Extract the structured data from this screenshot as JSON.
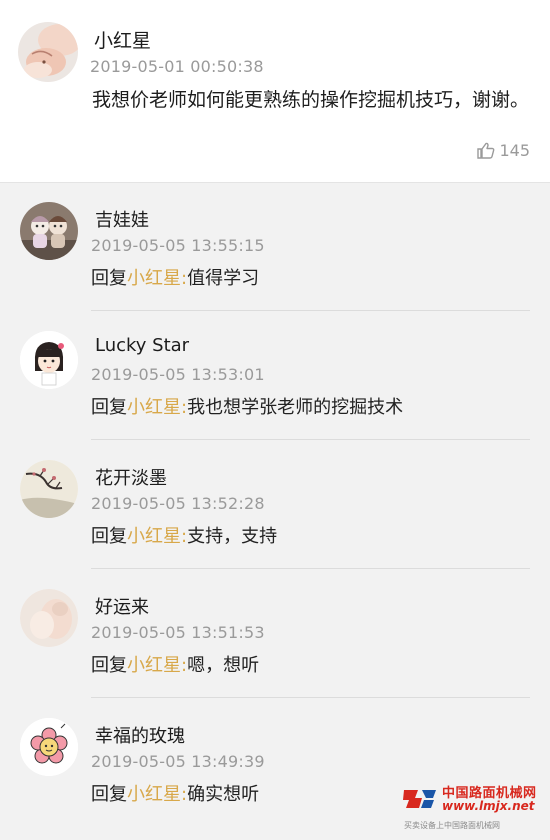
{
  "main_comment": {
    "avatar": "baby-photo-avatar",
    "username": "小红星",
    "timestamp": "2019-05-01 00:50:38",
    "text": "我想价老师如何能更熟练的操作挖掘机技巧，谢谢。",
    "likes": "145",
    "like_icon": "thumbs-up-icon"
  },
  "replies": [
    {
      "avatar": "doll-couple-avatar",
      "username": "吉娃娃",
      "timestamp": "2019-05-05 13:55:15",
      "prefix": "回复",
      "target": "小红星",
      "colon": ":",
      "text": "值得学习"
    },
    {
      "avatar": "cartoon-girl-avatar",
      "username": "Lucky Star",
      "timestamp": "2019-05-05 13:53:01",
      "prefix": "回复",
      "target": "小红星",
      "colon": ":",
      "text": "我也想学张老师的挖掘技术"
    },
    {
      "avatar": "ink-painting-avatar",
      "username": "花开淡墨",
      "timestamp": "2019-05-05 13:52:28",
      "prefix": "回复",
      "target": "小红星",
      "colon": ":",
      "text": "支持，支持"
    },
    {
      "avatar": "blurred-photo-avatar",
      "username": "好运来",
      "timestamp": "2019-05-05 13:51:53",
      "prefix": "回复",
      "target": "小红星",
      "colon": ":",
      "text": "嗯，想听"
    },
    {
      "avatar": "flower-avatar",
      "username": "幸福的玫瑰",
      "timestamp": "2019-05-05 13:49:39",
      "prefix": "回复",
      "target": "小红星",
      "colon": ":",
      "text": "确实想听"
    }
  ],
  "watermark": {
    "site_name": "中国路面机械网",
    "url": "www.lmjx.net",
    "subtitle": "买卖设备上中国路面机械网"
  },
  "colors": {
    "reply_target": "#d8a84a",
    "timestamp": "#9a9a9a",
    "watermark": "#d8281e"
  }
}
